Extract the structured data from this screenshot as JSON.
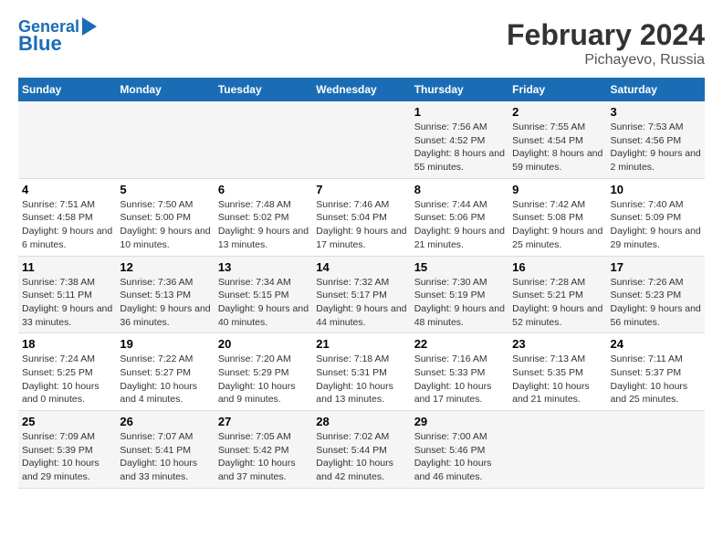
{
  "header": {
    "logo_line1": "General",
    "logo_line2": "Blue",
    "main_title": "February 2024",
    "subtitle": "Pichayevo, Russia"
  },
  "weekdays": [
    "Sunday",
    "Monday",
    "Tuesday",
    "Wednesday",
    "Thursday",
    "Friday",
    "Saturday"
  ],
  "weeks": [
    [
      {
        "day": "",
        "info": ""
      },
      {
        "day": "",
        "info": ""
      },
      {
        "day": "",
        "info": ""
      },
      {
        "day": "",
        "info": ""
      },
      {
        "day": "1",
        "info": "Sunrise: 7:56 AM\nSunset: 4:52 PM\nDaylight: 8 hours and 55 minutes."
      },
      {
        "day": "2",
        "info": "Sunrise: 7:55 AM\nSunset: 4:54 PM\nDaylight: 8 hours and 59 minutes."
      },
      {
        "day": "3",
        "info": "Sunrise: 7:53 AM\nSunset: 4:56 PM\nDaylight: 9 hours and 2 minutes."
      }
    ],
    [
      {
        "day": "4",
        "info": "Sunrise: 7:51 AM\nSunset: 4:58 PM\nDaylight: 9 hours and 6 minutes."
      },
      {
        "day": "5",
        "info": "Sunrise: 7:50 AM\nSunset: 5:00 PM\nDaylight: 9 hours and 10 minutes."
      },
      {
        "day": "6",
        "info": "Sunrise: 7:48 AM\nSunset: 5:02 PM\nDaylight: 9 hours and 13 minutes."
      },
      {
        "day": "7",
        "info": "Sunrise: 7:46 AM\nSunset: 5:04 PM\nDaylight: 9 hours and 17 minutes."
      },
      {
        "day": "8",
        "info": "Sunrise: 7:44 AM\nSunset: 5:06 PM\nDaylight: 9 hours and 21 minutes."
      },
      {
        "day": "9",
        "info": "Sunrise: 7:42 AM\nSunset: 5:08 PM\nDaylight: 9 hours and 25 minutes."
      },
      {
        "day": "10",
        "info": "Sunrise: 7:40 AM\nSunset: 5:09 PM\nDaylight: 9 hours and 29 minutes."
      }
    ],
    [
      {
        "day": "11",
        "info": "Sunrise: 7:38 AM\nSunset: 5:11 PM\nDaylight: 9 hours and 33 minutes."
      },
      {
        "day": "12",
        "info": "Sunrise: 7:36 AM\nSunset: 5:13 PM\nDaylight: 9 hours and 36 minutes."
      },
      {
        "day": "13",
        "info": "Sunrise: 7:34 AM\nSunset: 5:15 PM\nDaylight: 9 hours and 40 minutes."
      },
      {
        "day": "14",
        "info": "Sunrise: 7:32 AM\nSunset: 5:17 PM\nDaylight: 9 hours and 44 minutes."
      },
      {
        "day": "15",
        "info": "Sunrise: 7:30 AM\nSunset: 5:19 PM\nDaylight: 9 hours and 48 minutes."
      },
      {
        "day": "16",
        "info": "Sunrise: 7:28 AM\nSunset: 5:21 PM\nDaylight: 9 hours and 52 minutes."
      },
      {
        "day": "17",
        "info": "Sunrise: 7:26 AM\nSunset: 5:23 PM\nDaylight: 9 hours and 56 minutes."
      }
    ],
    [
      {
        "day": "18",
        "info": "Sunrise: 7:24 AM\nSunset: 5:25 PM\nDaylight: 10 hours and 0 minutes."
      },
      {
        "day": "19",
        "info": "Sunrise: 7:22 AM\nSunset: 5:27 PM\nDaylight: 10 hours and 4 minutes."
      },
      {
        "day": "20",
        "info": "Sunrise: 7:20 AM\nSunset: 5:29 PM\nDaylight: 10 hours and 9 minutes."
      },
      {
        "day": "21",
        "info": "Sunrise: 7:18 AM\nSunset: 5:31 PM\nDaylight: 10 hours and 13 minutes."
      },
      {
        "day": "22",
        "info": "Sunrise: 7:16 AM\nSunset: 5:33 PM\nDaylight: 10 hours and 17 minutes."
      },
      {
        "day": "23",
        "info": "Sunrise: 7:13 AM\nSunset: 5:35 PM\nDaylight: 10 hours and 21 minutes."
      },
      {
        "day": "24",
        "info": "Sunrise: 7:11 AM\nSunset: 5:37 PM\nDaylight: 10 hours and 25 minutes."
      }
    ],
    [
      {
        "day": "25",
        "info": "Sunrise: 7:09 AM\nSunset: 5:39 PM\nDaylight: 10 hours and 29 minutes."
      },
      {
        "day": "26",
        "info": "Sunrise: 7:07 AM\nSunset: 5:41 PM\nDaylight: 10 hours and 33 minutes."
      },
      {
        "day": "27",
        "info": "Sunrise: 7:05 AM\nSunset: 5:42 PM\nDaylight: 10 hours and 37 minutes."
      },
      {
        "day": "28",
        "info": "Sunrise: 7:02 AM\nSunset: 5:44 PM\nDaylight: 10 hours and 42 minutes."
      },
      {
        "day": "29",
        "info": "Sunrise: 7:00 AM\nSunset: 5:46 PM\nDaylight: 10 hours and 46 minutes."
      },
      {
        "day": "",
        "info": ""
      },
      {
        "day": "",
        "info": ""
      }
    ]
  ]
}
